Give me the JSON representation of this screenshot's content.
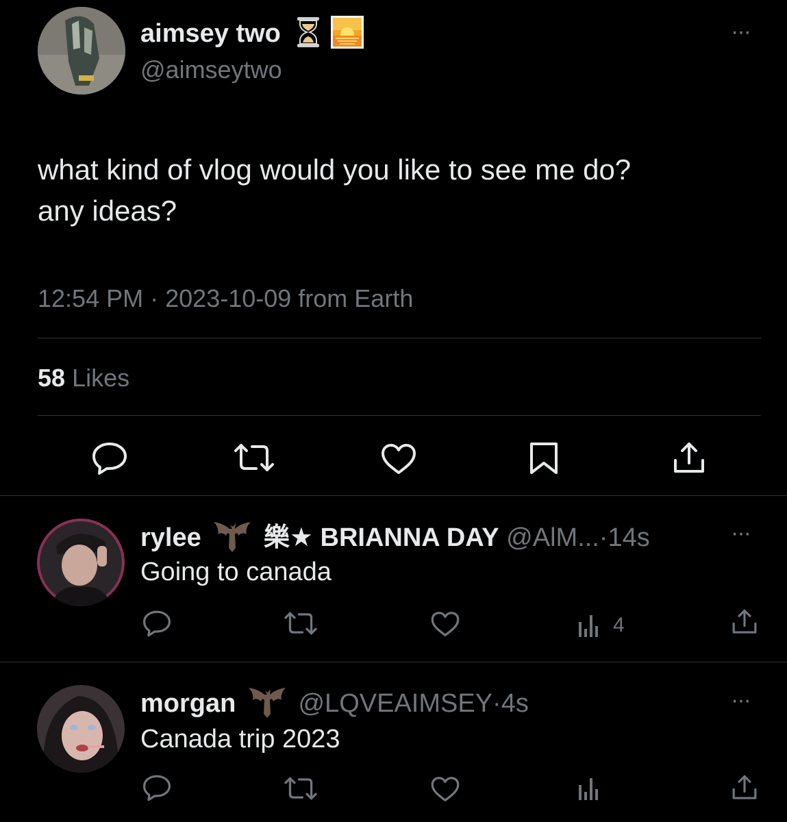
{
  "main_tweet": {
    "display_name": "aimsey two",
    "name_emojis": [
      "⏳",
      "🌅"
    ],
    "handle": "@aimseytwo",
    "more": "···",
    "text_line1": "what kind of vlog would you like to see me do?",
    "text_line2": "any ideas?",
    "time": "12:54 PM",
    "separator": "·",
    "date": "2023-10-09",
    "source": "from Earth",
    "likes_count": "58",
    "likes_label": "Likes"
  },
  "replies": [
    {
      "display_name": "rylee",
      "name_emoji": "🦇",
      "name_suffix": "樂★ BRIANNA DAY",
      "handle": "@AlM...",
      "separator": "·",
      "time": "14s",
      "text": "Going to canada",
      "views": "4",
      "more": "···"
    },
    {
      "display_name": "morgan",
      "name_emoji": "🦇",
      "handle": "@LQVEAIMSEY",
      "separator": "·",
      "time": "4s",
      "text": "Canada trip 2023",
      "views": "",
      "more": "···"
    }
  ],
  "colors": {
    "background": "#000000",
    "text": "#e7e9ea",
    "muted": "#71767b",
    "divider": "#2f3336"
  },
  "icons": [
    "reply-icon",
    "retweet-icon",
    "like-icon",
    "bookmark-icon",
    "share-icon",
    "views-icon",
    "more-icon"
  ]
}
